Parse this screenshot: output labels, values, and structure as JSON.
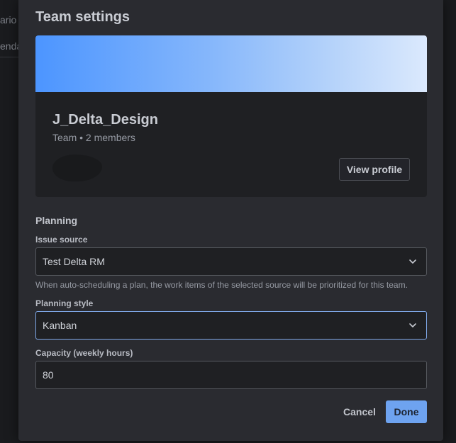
{
  "background": {
    "partial_text_1": "ario",
    "partial_text_2": "enda"
  },
  "dialog": {
    "title": "Team settings",
    "team": {
      "name": "J_Delta_Design",
      "meta": "Team • 2 members",
      "view_profile_label": "View profile",
      "banner_colors": [
        "#4c95ff",
        "#dbe9fd"
      ]
    },
    "planning": {
      "heading": "Planning",
      "issue_source": {
        "label": "Issue source",
        "value": "Test Delta RM",
        "helper": "When auto-scheduling a plan, the work items of the selected source will be prioritized for this team."
      },
      "planning_style": {
        "label": "Planning style",
        "value": "Kanban"
      },
      "capacity": {
        "label": "Capacity (weekly hours)",
        "value": "80"
      }
    },
    "footer": {
      "cancel_label": "Cancel",
      "done_label": "Done"
    }
  },
  "colors": {
    "accent": "#6ea3f0",
    "focus_border": "#7fa8e8",
    "dialog_bg": "#2a2b30"
  },
  "icons": {
    "dropdown": "chevron-down-icon"
  }
}
